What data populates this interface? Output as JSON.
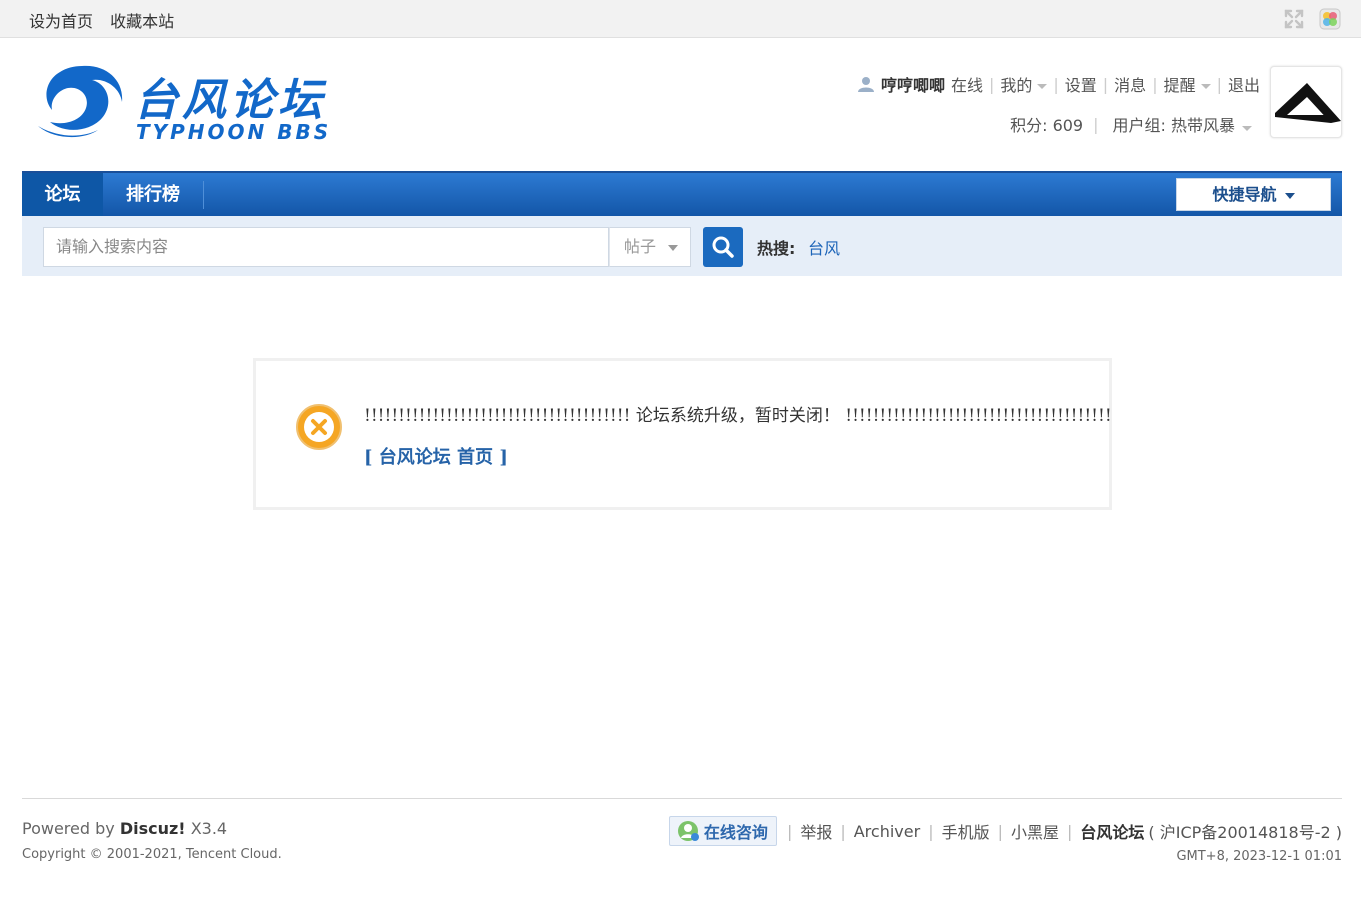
{
  "topbar": {
    "set_home": "设为首页",
    "bookmark": "收藏本站"
  },
  "logo": {
    "title": "台风论坛",
    "subtitle": "TYPHOON BBS"
  },
  "user": {
    "name": "哼哼唧唧",
    "status": "在线",
    "my": "我的",
    "settings": "设置",
    "messages": "消息",
    "reminders": "提醒",
    "logout": "退出",
    "points": "积分: 609",
    "group": "用户组: 热带风暴"
  },
  "nav": {
    "forum": "论坛",
    "ranking": "排行榜",
    "quick_nav": "快捷导航"
  },
  "search": {
    "placeholder": "请输入搜索内容",
    "type": "帖子",
    "hot_label": "热搜:",
    "hot_word": "台风"
  },
  "message": {
    "text": "!!!!!!!!!!!!!!!!!!!!!!!!!!!!!!!!!!!!!!! 论坛系统升级，暂时关闭！ !!!!!!!!!!!!!!!!!!!!!!!!!!!!!!!!!!!!!!!",
    "link": "[ 台风论坛 首页 ]"
  },
  "footer": {
    "powered_prefix": "Powered by",
    "powered_brand": "Discuz!",
    "powered_version": "X3.4",
    "copyright": "Copyright © 2001-2021, Tencent Cloud.",
    "consult": "在线咨询",
    "report": "举报",
    "archiver": "Archiver",
    "mobile": "手机版",
    "blackroom": "小黑屋",
    "site": "台风论坛",
    "icp": "( 沪ICP备20014818号-2 )",
    "gmt": "GMT+8, 2023-12-1 01:01"
  }
}
